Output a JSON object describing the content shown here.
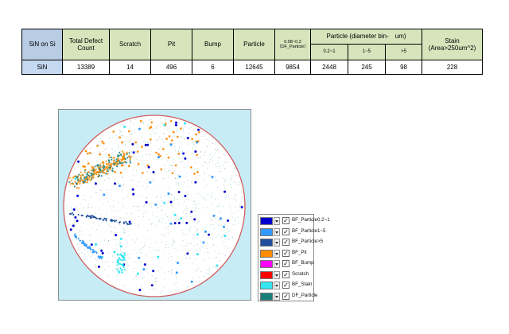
{
  "table": {
    "headers": {
      "sample": "SiN on Si",
      "total": "Total Defect Count",
      "scratch": "Scratch",
      "pit": "Pit",
      "bump": "Bump",
      "particle": "Particle",
      "df_particle": "0.08~0.2 （DF_Particle）",
      "particle_group": "Particle (diameter bin-　um)",
      "bin1": "0.2~1",
      "bin2": "1~5",
      "bin3": ">5",
      "stain": "Stain (Area>250um^2)"
    },
    "row": {
      "sample": "SiN",
      "total": "13389",
      "scratch": "14",
      "pit": "496",
      "bump": "6",
      "particle": "12645",
      "df_particle": "9854",
      "bin1": "2448",
      "bin2": "245",
      "bin3": "98",
      "stain": "228"
    }
  },
  "legend": {
    "items": [
      {
        "label": "BF_Particle0.2~1",
        "color": "#0000cc",
        "checked": "✓"
      },
      {
        "label": "BF_Particle1~5",
        "color": "#3399ff",
        "checked": "✓"
      },
      {
        "label": "BF_Particle>5",
        "color": "#1f4e9a",
        "checked": "✓"
      },
      {
        "label": "BF_Pit",
        "color": "#ff8c00",
        "checked": "✓"
      },
      {
        "label": "BF_Bump",
        "color": "#ff00ff",
        "checked": "✓"
      },
      {
        "label": "Scratch",
        "color": "#ff0000",
        "checked": "✓"
      },
      {
        "label": "BF_Stain",
        "color": "#33e6f0",
        "checked": "✓"
      },
      {
        "label": "DF_Particle",
        "color": "#1a7f7a",
        "checked": "✓"
      }
    ]
  },
  "wafer": {
    "background": "#c7ecf6",
    "wafer_fill": "#ffffff",
    "edge_color": "#d06060"
  }
}
